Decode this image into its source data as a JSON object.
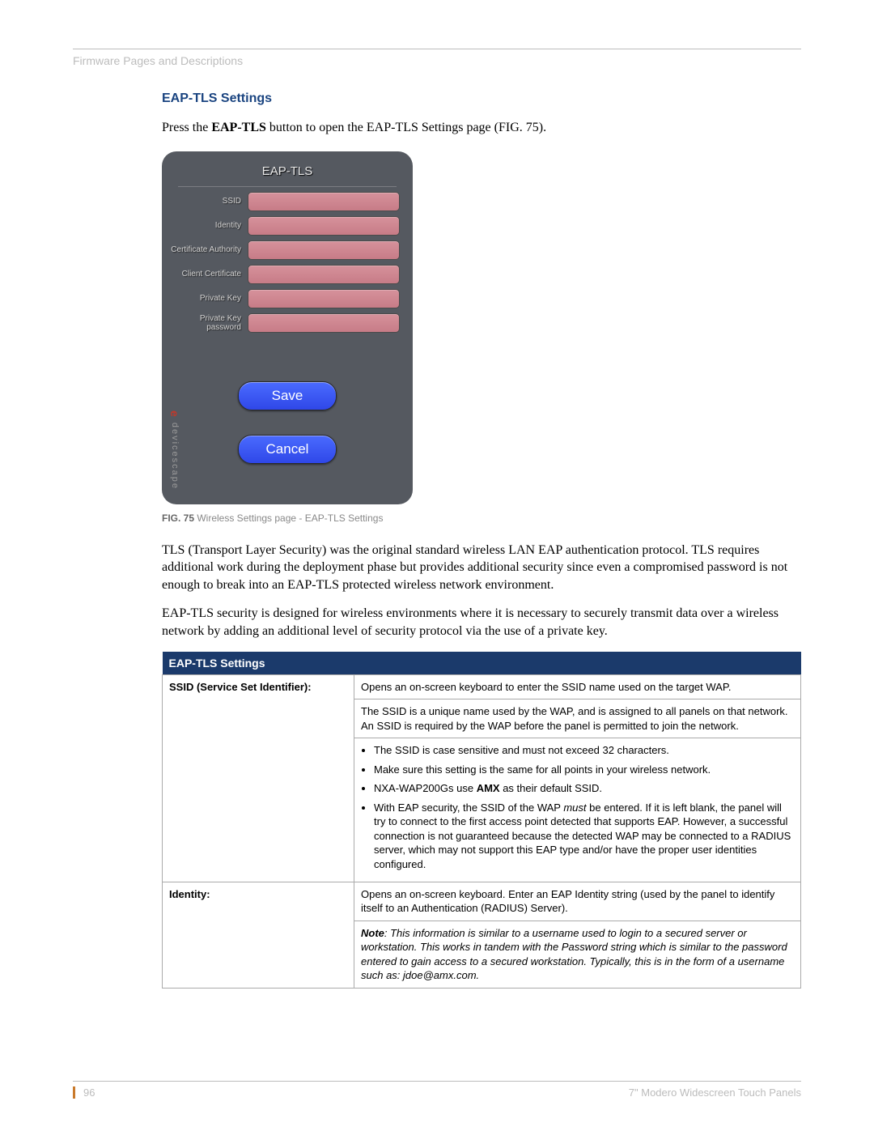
{
  "header": "Firmware Pages and Descriptions",
  "section_title": "EAP-TLS Settings",
  "intro": {
    "prefix": "Press the ",
    "bold": "EAP-TLS",
    "suffix": " button to open the EAP-TLS Settings page (FIG. 75)."
  },
  "screenshot": {
    "title": "EAP-TLS",
    "fields": [
      "SSID",
      "Identity",
      "Certificate Authority",
      "Client Certificate",
      "Private Key",
      "Private Key password"
    ],
    "save": "Save",
    "cancel": "Cancel",
    "brand_e": "e",
    "brand_text": "devicescape"
  },
  "figure": {
    "num": "FIG. 75",
    "caption": "  Wireless Settings page - EAP-TLS Settings"
  },
  "paragraphs": [
    "TLS (Transport Layer Security) was the original standard wireless LAN EAP authentication protocol. TLS requires additional work during the deployment phase but provides additional security since even a compromised password is not enough to break into an EAP-TLS protected wireless network environment.",
    "EAP-TLS security is designed for wireless environments where it is necessary to securely transmit data over a wireless network by adding an additional level of security protocol via the use of a private key."
  ],
  "table": {
    "header": "EAP-TLS Settings",
    "rows": [
      {
        "label": "SSID (Service Set Identifier):",
        "cells": [
          "Opens an on-screen keyboard to enter the SSID name used on the target WAP.",
          "The SSID is a unique name used by the WAP, and is assigned to all panels on that network. An SSID is required by the WAP before the panel is permitted to join the network.",
          {
            "bullets": [
              "The SSID is case sensitive and must not exceed 32 characters.",
              "Make sure this setting is the same for all points in your wireless network.",
              {
                "prefix": "NXA-WAP200Gs use ",
                "bold": "AMX",
                "suffix": " as their default SSID."
              },
              {
                "prefix": "With EAP security, the SSID of the WAP ",
                "italic": "must",
                "suffix": " be entered. If it is left blank, the panel will try to connect to the first access point detected that supports EAP. However, a successful connection is not guaranteed because the detected WAP may be connected to a RADIUS server, which may not support this EAP type and/or have the proper user identities configured."
              }
            ]
          }
        ]
      },
      {
        "label": "Identity:",
        "cells": [
          "Opens an on-screen keyboard. Enter an EAP Identity string (used by the panel to identify itself to an Authentication (RADIUS) Server).",
          {
            "note_bold": "Note",
            "note_text": ": This information is similar to a username used to login to a secured server or workstation. This works in tandem with the Password string which is similar to the password entered to gain access to a secured workstation. Typically, this is in the form of a username such as: jdoe@amx.com."
          }
        ]
      }
    ]
  },
  "footer": {
    "page": "96",
    "product": "7\" Modero Widescreen Touch Panels"
  }
}
